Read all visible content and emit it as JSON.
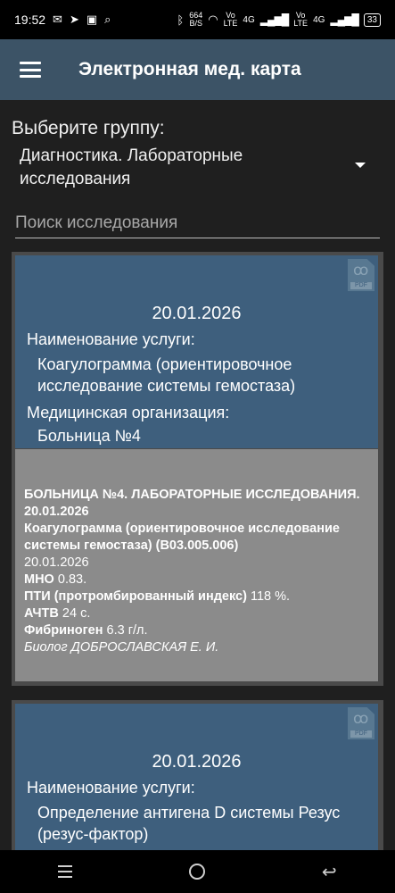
{
  "status_bar": {
    "time": "19:52",
    "net_speed_value": "664",
    "net_speed_unit": "B/S",
    "lte1_top": "Vo",
    "lte1_bottom": "LTE",
    "lte2_top": "Vo",
    "lte2_bottom": "LTE",
    "network": "4G",
    "network2": "4G",
    "battery": "33"
  },
  "appbar": {
    "title": "Электронная мед. карта"
  },
  "group": {
    "label": "Выберите группу:",
    "selected": "Диагностика. Лабораторные исследования"
  },
  "search": {
    "placeholder": "Поиск исследования",
    "value": ""
  },
  "cards": [
    {
      "date": "20.01.2026",
      "service_label": "Наименование услуги:",
      "service": "Коагулограмма (ориентировочное исследование системы гемостаза)",
      "org_label": "Медицинская организация:",
      "org": "Больница №4",
      "pdf_label": "PDF",
      "details": {
        "header": "БОЛЬНИЦА №4. ЛАБОРАТОРНЫЕ ИССЛЕДОВАНИЯ. 20.01.2026",
        "test_name": "Коагулограмма (ориентировочное исследование системы гемостаза) (В03.005.006)",
        "date": "20.01.2026",
        "results": [
          {
            "name": "МНО",
            "value": "0.83."
          },
          {
            "name": "ПТИ (протромбированный индекс)",
            "value": "118 %."
          },
          {
            "name": "АЧТВ",
            "value": "24 с."
          },
          {
            "name": "Фибриноген",
            "value": "6.3 г/л."
          }
        ],
        "signature": "Биолог ДОБРОСЛАВСКАЯ Е. И."
      }
    },
    {
      "date": "20.01.2026",
      "service_label": "Наименование услуги:",
      "service": "Определение антигена D системы Резус (резус-фактор)",
      "pdf_label": "PDF"
    }
  ]
}
